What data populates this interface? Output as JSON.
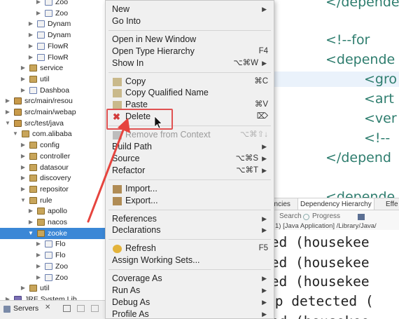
{
  "tree": {
    "items": [
      {
        "label": "Zoo",
        "icon": "java",
        "level": 6,
        "twisty": "right"
      },
      {
        "label": "Zoo",
        "icon": "java",
        "level": 6,
        "twisty": "right"
      },
      {
        "label": "Dynam",
        "icon": "java",
        "level": 5,
        "twisty": "right"
      },
      {
        "label": "Dynam",
        "icon": "java",
        "level": 5,
        "twisty": "right"
      },
      {
        "label": "FlowR",
        "icon": "java",
        "level": 5,
        "twisty": "right"
      },
      {
        "label": "FlowR",
        "icon": "java",
        "level": 5,
        "twisty": "right"
      },
      {
        "label": "service",
        "icon": "pkg",
        "level": 4,
        "twisty": "right"
      },
      {
        "label": "util",
        "icon": "pkg",
        "level": 4,
        "twisty": "right"
      },
      {
        "label": "Dashboa",
        "icon": "java",
        "level": 4,
        "twisty": "right"
      },
      {
        "label": "src/main/resou",
        "icon": "src",
        "level": 2,
        "twisty": "right"
      },
      {
        "label": "src/main/webap",
        "icon": "src",
        "level": 2,
        "twisty": "right"
      },
      {
        "label": "src/test/java",
        "icon": "src",
        "level": 2,
        "twisty": "down"
      },
      {
        "label": "com.alibaba",
        "icon": "pkg",
        "level": 3,
        "twisty": "down"
      },
      {
        "label": "config",
        "icon": "pkg",
        "level": 4,
        "twisty": "right"
      },
      {
        "label": "controller",
        "icon": "pkg",
        "level": 4,
        "twisty": "right"
      },
      {
        "label": "datasour",
        "icon": "pkg",
        "level": 4,
        "twisty": "right"
      },
      {
        "label": "discovery",
        "icon": "pkg",
        "level": 4,
        "twisty": "right"
      },
      {
        "label": "repositor",
        "icon": "pkg",
        "level": 4,
        "twisty": "right"
      },
      {
        "label": "rule",
        "icon": "pkg",
        "level": 4,
        "twisty": "down"
      },
      {
        "label": "apollo",
        "icon": "pkg",
        "level": 5,
        "twisty": "right"
      },
      {
        "label": "nacos",
        "icon": "pkg",
        "level": 5,
        "twisty": "right"
      },
      {
        "label": "zooke",
        "icon": "pkg",
        "level": 5,
        "twisty": "down",
        "selected": true
      },
      {
        "label": "Flo",
        "icon": "java",
        "level": 6,
        "twisty": "right"
      },
      {
        "label": "Flo",
        "icon": "java",
        "level": 6,
        "twisty": "right"
      },
      {
        "label": "Zoo",
        "icon": "java",
        "level": 6,
        "twisty": "right"
      },
      {
        "label": "Zoo",
        "icon": "java",
        "level": 6,
        "twisty": "right"
      },
      {
        "label": "util",
        "icon": "pkg",
        "level": 4,
        "twisty": "right"
      },
      {
        "label": "JRE System Lib",
        "icon": "jar",
        "level": 2,
        "twisty": "right"
      },
      {
        "label": "Maven Depende",
        "icon": "jar",
        "level": 2,
        "twisty": "right"
      }
    ]
  },
  "servers": {
    "tab_label": "Servers",
    "close_icon": "close-icon"
  },
  "context_menu": {
    "items": [
      {
        "type": "item",
        "label": "New",
        "submenu": true
      },
      {
        "type": "item",
        "label": "Go Into"
      },
      {
        "type": "sep"
      },
      {
        "type": "item",
        "label": "Open in New Window"
      },
      {
        "type": "item",
        "label": "Open Type Hierarchy",
        "shortcut": "F4"
      },
      {
        "type": "item",
        "label": "Show In",
        "shortcut": "⌥⌘W",
        "submenu": true
      },
      {
        "type": "sep"
      },
      {
        "type": "item",
        "label": "Copy",
        "shortcut": "⌘C",
        "icon": "copy-icon"
      },
      {
        "type": "item",
        "label": "Copy Qualified Name",
        "icon": "copy-qualified-icon"
      },
      {
        "type": "item",
        "label": "Paste",
        "shortcut": "⌘V",
        "icon": "paste-icon"
      },
      {
        "type": "item",
        "label": "Delete",
        "shortcut": "⌦",
        "icon": "delete-icon"
      },
      {
        "type": "sep"
      },
      {
        "type": "item",
        "label": "Remove from Context",
        "shortcut": "⌥⌘⇧↓",
        "icon": "remove-context-icon",
        "disabled": true
      },
      {
        "type": "item",
        "label": "Build Path",
        "submenu": true
      },
      {
        "type": "item",
        "label": "Source",
        "shortcut": "⌥⌘S",
        "submenu": true
      },
      {
        "type": "item",
        "label": "Refactor",
        "shortcut": "⌥⌘T",
        "submenu": true
      },
      {
        "type": "sep"
      },
      {
        "type": "item",
        "label": "Import...",
        "icon": "import-icon"
      },
      {
        "type": "item",
        "label": "Export...",
        "icon": "export-icon"
      },
      {
        "type": "sep"
      },
      {
        "type": "item",
        "label": "References",
        "submenu": true
      },
      {
        "type": "item",
        "label": "Declarations",
        "submenu": true
      },
      {
        "type": "sep"
      },
      {
        "type": "item",
        "label": "Refresh",
        "shortcut": "F5",
        "icon": "refresh-icon"
      },
      {
        "type": "item",
        "label": "Assign Working Sets..."
      },
      {
        "type": "sep"
      },
      {
        "type": "item",
        "label": "Coverage As",
        "submenu": true
      },
      {
        "type": "item",
        "label": "Run As",
        "submenu": true
      },
      {
        "type": "item",
        "label": "Debug As",
        "submenu": true
      },
      {
        "type": "item",
        "label": "Profile As",
        "submenu": true
      }
    ],
    "submenu_arrow": "▶",
    "highlighted": "Delete",
    "highlight_color": "#e05252"
  },
  "editor": {
    "lines": [
      "</depende",
      "",
      "<!--for",
      "<depende",
      "<gro",
      "<art",
      "<ver",
      "<!--",
      "</depend",
      "",
      "<depende"
    ],
    "text_color": "#2e7d6e"
  },
  "maven_tabs": {
    "tabs": [
      "encies",
      "Dependency Hierarchy",
      "Effe"
    ],
    "active": "Dependency Hierarchy"
  },
  "console": {
    "toolbar": {
      "search": "Search",
      "progress": "Progress",
      "path": "1) [Java Application] /Library/Java/"
    },
    "lines": [
      "ted (housekee",
      "ted (housekee",
      "ted (housekee",
      "ap detected (",
      "ted (housekee"
    ]
  }
}
